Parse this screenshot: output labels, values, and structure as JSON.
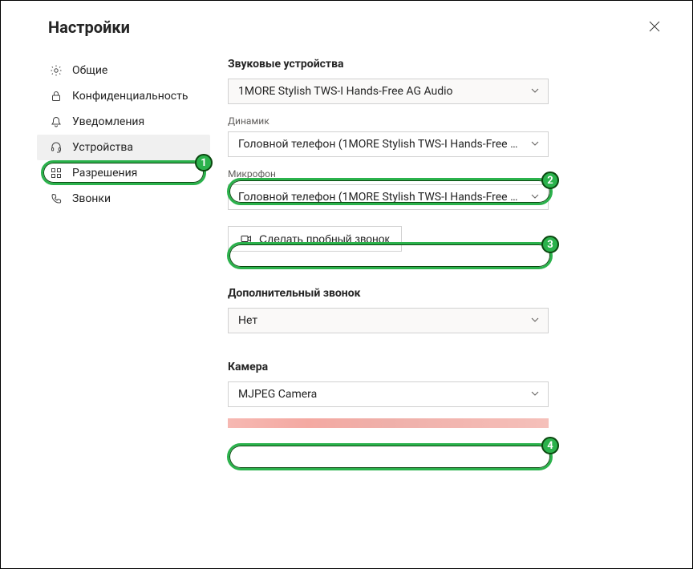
{
  "header": {
    "title": "Настройки"
  },
  "sidebar": {
    "items": [
      {
        "label": "Общие",
        "icon": "gear"
      },
      {
        "label": "Конфиденциальность",
        "icon": "lock"
      },
      {
        "label": "Уведомления",
        "icon": "bell"
      },
      {
        "label": "Устройства",
        "icon": "headset",
        "active": true
      },
      {
        "label": "Разрешения",
        "icon": "grid"
      },
      {
        "label": "Звонки",
        "icon": "phone"
      }
    ]
  },
  "content": {
    "audio_devices_heading": "Звуковые устройства",
    "audio_device_value": "1MORE Stylish TWS-I Hands-Free AG Audio",
    "speaker_label": "Динамик",
    "speaker_value": "Головной телефон (1MORE Stylish TWS-I Hands-Free A...",
    "microphone_label": "Микрофон",
    "microphone_value": "Головной телефон (1MORE Stylish TWS-I Hands-Free A...",
    "test_call_label": "Сделать пробный звонок",
    "secondary_ringer_heading": "Дополнительный звонок",
    "secondary_ringer_value": "Нет",
    "camera_heading": "Камера",
    "camera_value": "MJPEG Camera"
  },
  "annotations": {
    "1": "1",
    "2": "2",
    "3": "3",
    "4": "4"
  }
}
